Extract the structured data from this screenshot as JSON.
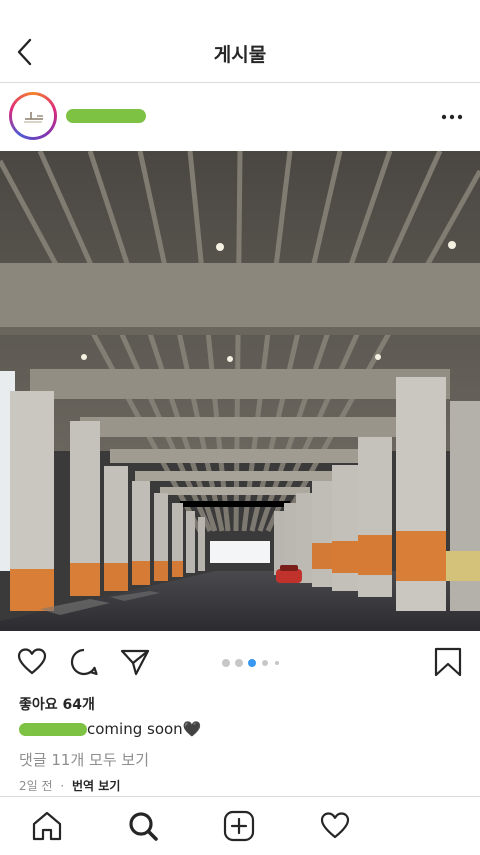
{
  "header": {
    "title": "게시물",
    "back_icon": "chevron-left-icon"
  },
  "post": {
    "username_redacted": true,
    "more_icon": "more-horizontal-icon",
    "image_description": "photo",
    "carousel": {
      "count": 5,
      "active_index": 3
    },
    "actions": {
      "like_icon": "heart-icon",
      "comment_icon": "comment-icon",
      "share_icon": "share-icon",
      "save_icon": "bookmark-icon"
    },
    "likes_text": "좋아요 64개",
    "caption_text": "coming soon🖤",
    "view_comments": "댓글 11개 모두 보기",
    "time_ago": "2일 전",
    "separator": "·",
    "translate": "번역 보기"
  },
  "tabbar": {
    "items": [
      "home-icon",
      "search-icon",
      "add-icon",
      "activity-heart-icon"
    ]
  },
  "colors": {
    "redaction_green": "#7dc242",
    "carousel_active": "#3897f0",
    "divider": "#dbdbdb",
    "muted_text": "#8e8e8e"
  }
}
